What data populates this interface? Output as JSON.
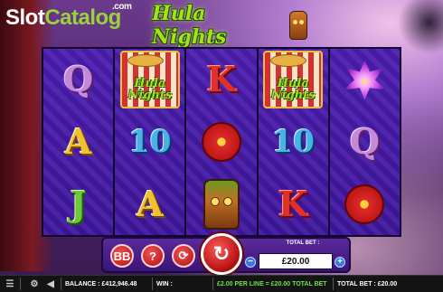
{
  "brand": {
    "slot": "Slot",
    "catalog": "Catalog",
    "com": ".com"
  },
  "game": {
    "title": "Hula Nights"
  },
  "reels": [
    [
      {
        "type": "Q",
        "icon": "q-symbol"
      },
      {
        "type": "A",
        "icon": "a-symbol"
      },
      {
        "type": "J",
        "icon": "j-symbol"
      }
    ],
    [
      {
        "type": "WILD",
        "icon": "hula-nights-wild-symbol",
        "text": "Hula Nights"
      },
      {
        "type": "10",
        "icon": "ten-symbol"
      },
      {
        "type": "A",
        "icon": "a-symbol"
      }
    ],
    [
      {
        "type": "K",
        "icon": "k-symbol"
      },
      {
        "type": "FLOWER",
        "icon": "red-flower-symbol"
      },
      {
        "type": "TIKI",
        "icon": "tiki-mask-symbol"
      }
    ],
    [
      {
        "type": "WILD",
        "icon": "hula-nights-wild-symbol",
        "text": "Hula Nights"
      },
      {
        "type": "10",
        "icon": "ten-symbol"
      },
      {
        "type": "K",
        "icon": "k-symbol"
      }
    ],
    [
      {
        "type": "LOTUS",
        "icon": "purple-lotus-symbol"
      },
      {
        "type": "Q",
        "icon": "q-symbol"
      },
      {
        "type": "FLOWER",
        "icon": "red-flower-symbol"
      }
    ]
  ],
  "controls": {
    "total_bet_label": "TOTAL BET :",
    "total_bet_value": "£20.00",
    "minus": "−",
    "plus": "+",
    "autoplay_label": "BB",
    "help_label": "?",
    "spin_icon": "spin-arrow-icon"
  },
  "status": {
    "balance": "BALANCE : £412,946.48",
    "win": "WIN :",
    "per_line": "£2.00 PER LINE = £20.00 TOTAL BET",
    "total_bet": "TOTAL BET : £20.00"
  },
  "colors": {
    "title_green": "#a6e21b",
    "spin_red": "#d01818",
    "reel_purple": "#3a1590"
  }
}
